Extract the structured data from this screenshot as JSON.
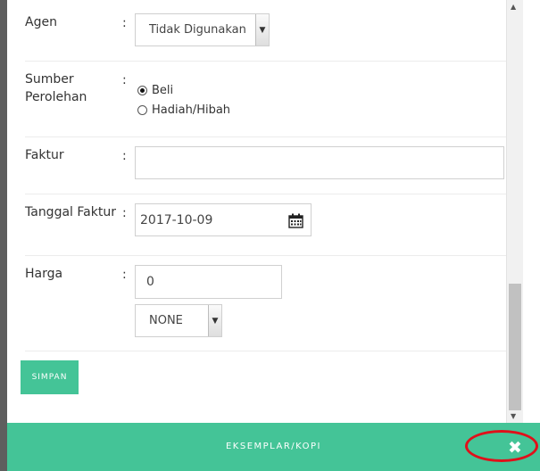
{
  "form": {
    "agen": {
      "label": "Agen",
      "colon": ":",
      "value": "Tidak Digunakan",
      "arrow_icon": "chevron-down"
    },
    "sumber": {
      "label": "Sumber Perolehan",
      "colon": ":",
      "options": [
        {
          "label": "Beli",
          "checked": true
        },
        {
          "label": "Hadiah/Hibah",
          "checked": false
        }
      ]
    },
    "faktur": {
      "label": "Faktur",
      "colon": ":",
      "value": ""
    },
    "tanggal": {
      "label": "Tanggal Faktur",
      "colon": ":",
      "value": "2017-10-09",
      "icon": "calendar-icon"
    },
    "harga": {
      "label": "Harga",
      "colon": ":",
      "value": "0",
      "currency": "NONE",
      "arrow_icon": "chevron-down"
    }
  },
  "buttons": {
    "simpan": "SIMPAN"
  },
  "footer": {
    "title": "EKSEMPLAR/KOPI",
    "close_icon": "close-icon",
    "close_glyph": "✖"
  },
  "colors": {
    "accent": "#44c497",
    "annotation": "#e0101a"
  }
}
